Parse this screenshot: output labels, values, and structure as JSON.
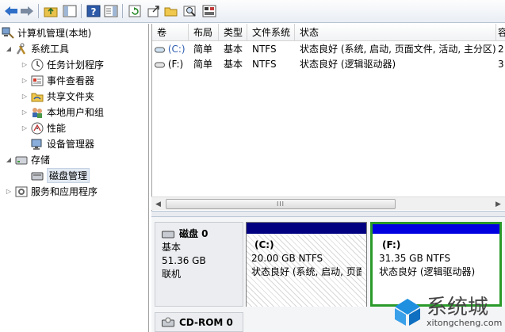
{
  "toolbar": {
    "icons": [
      "back-arrow-icon",
      "forward-arrow-icon",
      "up-folder-icon",
      "show-hide-tree-icon",
      "help-icon",
      "properties-pane-icon",
      "refresh-icon",
      "export-icon",
      "open-folder-icon",
      "search-icon",
      "disk-props-icon"
    ]
  },
  "tree": {
    "root": "计算机管理(本地)",
    "system_tools": "系统工具",
    "task_scheduler": "任务计划程序",
    "event_viewer": "事件查看器",
    "shared_folders": "共享文件夹",
    "local_users": "本地用户和组",
    "performance": "性能",
    "device_manager": "设备管理器",
    "storage": "存储",
    "disk_management": "磁盘管理",
    "services_apps": "服务和应用程序"
  },
  "volumes": {
    "headers": [
      "卷",
      "布局",
      "类型",
      "文件系统",
      "状态",
      "容"
    ],
    "rows": [
      {
        "volume": "(C:)",
        "layout": "简单",
        "type": "基本",
        "fs": "NTFS",
        "status": "状态良好 (系统, 启动, 页面文件, 活动, 主分区)",
        "cap": "2"
      },
      {
        "volume": "(F:)",
        "layout": "简单",
        "type": "基本",
        "fs": "NTFS",
        "status": "状态良好 (逻辑驱动器)",
        "cap": "3"
      }
    ]
  },
  "scrollbar": {
    "grip": "III",
    "left": "◀",
    "right": "▶"
  },
  "disk0": {
    "name": "磁盘 0",
    "type": "基本",
    "size": "51.36 GB",
    "state": "联机",
    "partitions": [
      {
        "name": "(C:)",
        "size": "20.00 GB NTFS",
        "status": "状态良好 (系统, 启动, 页面",
        "bar_color": "#000080"
      },
      {
        "name": "(F:)",
        "size": "31.35 GB NTFS",
        "status": "状态良好 (逻辑驱动器)",
        "bar_color": "#0000e0",
        "selected_border": "#2a9a2a"
      }
    ]
  },
  "cdrom": {
    "name": "CD-ROM 0"
  },
  "watermark": {
    "brand": "系统城",
    "url": "xitongcheng.com"
  }
}
